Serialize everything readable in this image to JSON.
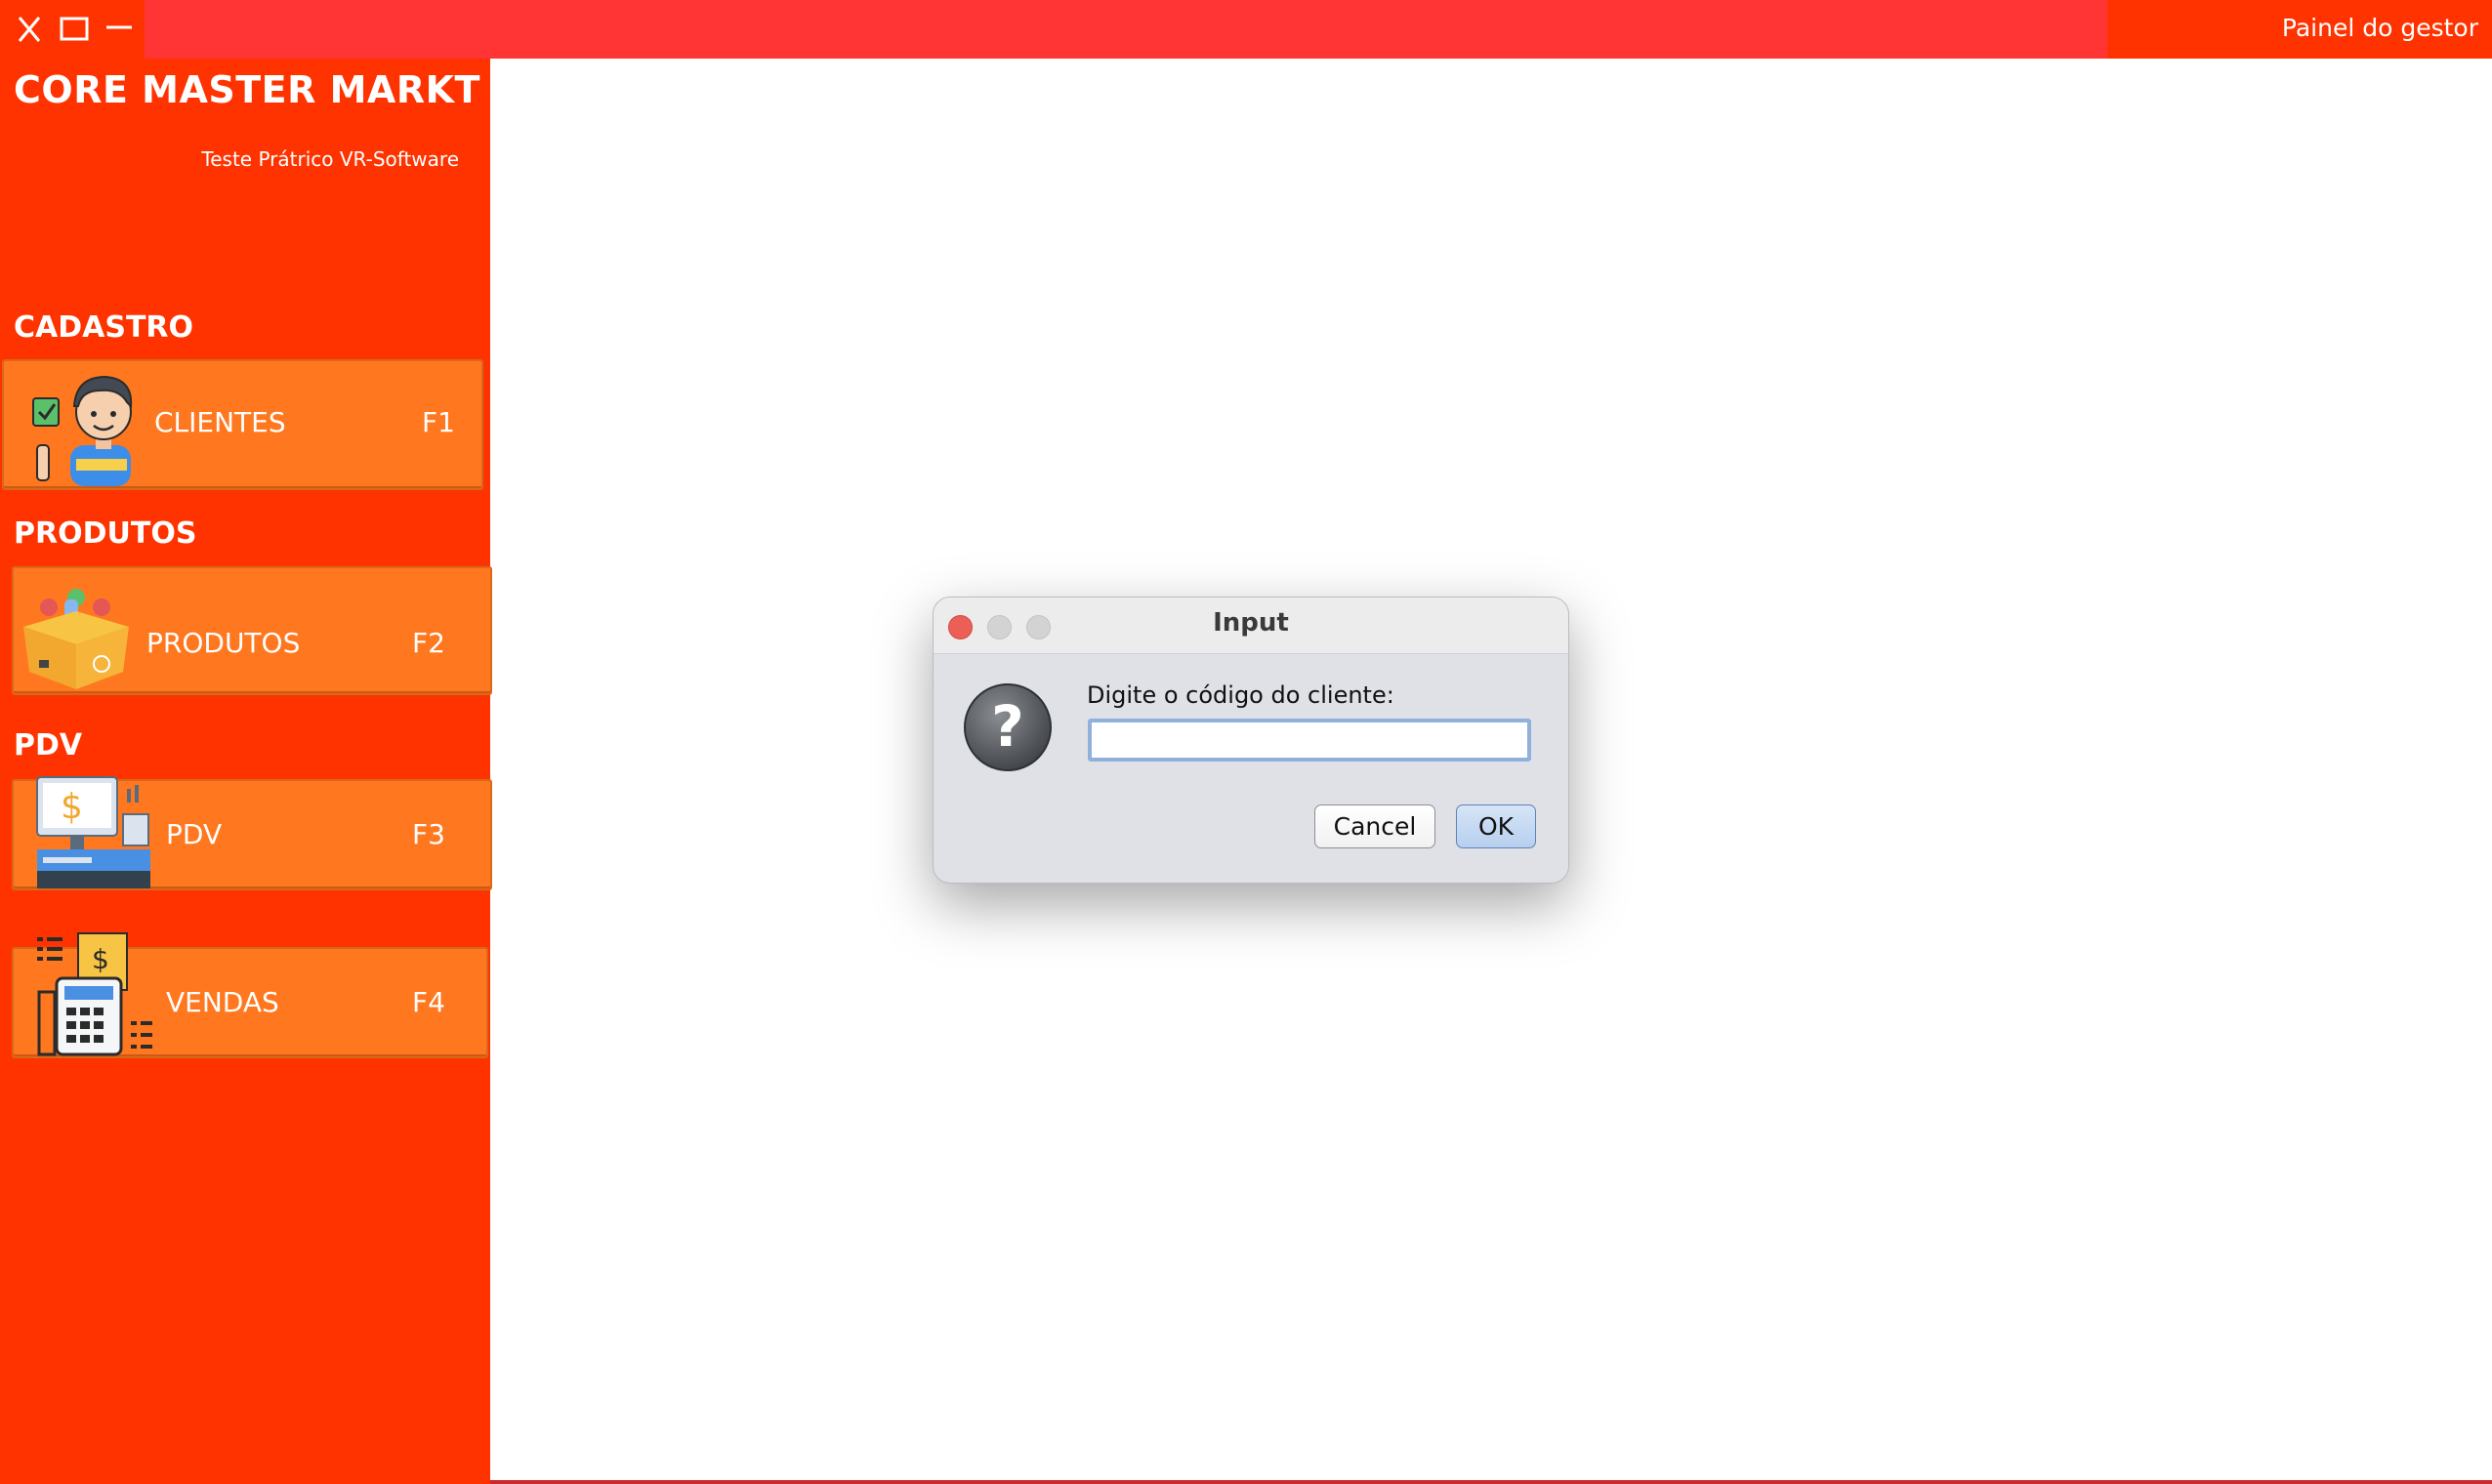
{
  "window": {
    "panel_label": "Painel do gestor",
    "controls": [
      "close-icon",
      "maximize-icon",
      "minimize-icon"
    ]
  },
  "sidebar": {
    "app_title": "CORE MASTER MARKT",
    "app_subtitle": "Teste Prátrico VR-Software",
    "sections": [
      {
        "label": "CADASTRO"
      },
      {
        "label": "PRODUTOS"
      },
      {
        "label": "PDV"
      }
    ],
    "items": [
      {
        "label": "CLIENTES",
        "shortcut": "F1",
        "icon": "customer-icon"
      },
      {
        "label": "PRODUTOS",
        "shortcut": "F2",
        "icon": "products-box-icon"
      },
      {
        "label": "PDV",
        "shortcut": "F3",
        "icon": "pos-terminal-icon"
      },
      {
        "label": "VENDAS",
        "shortcut": "F4",
        "icon": "sales-receipt-icon"
      }
    ]
  },
  "dialog": {
    "title": "Input",
    "prompt": "Digite o código do cliente:",
    "input_value": "",
    "cancel_label": "Cancel",
    "ok_label": "OK",
    "icon": "question-icon"
  },
  "colors": {
    "sidebar_bg": "#ff3300",
    "topbar_bg": "#ff3535",
    "menu_button_bg": "#ff771e",
    "dialog_bg": "#dfe1e6"
  }
}
